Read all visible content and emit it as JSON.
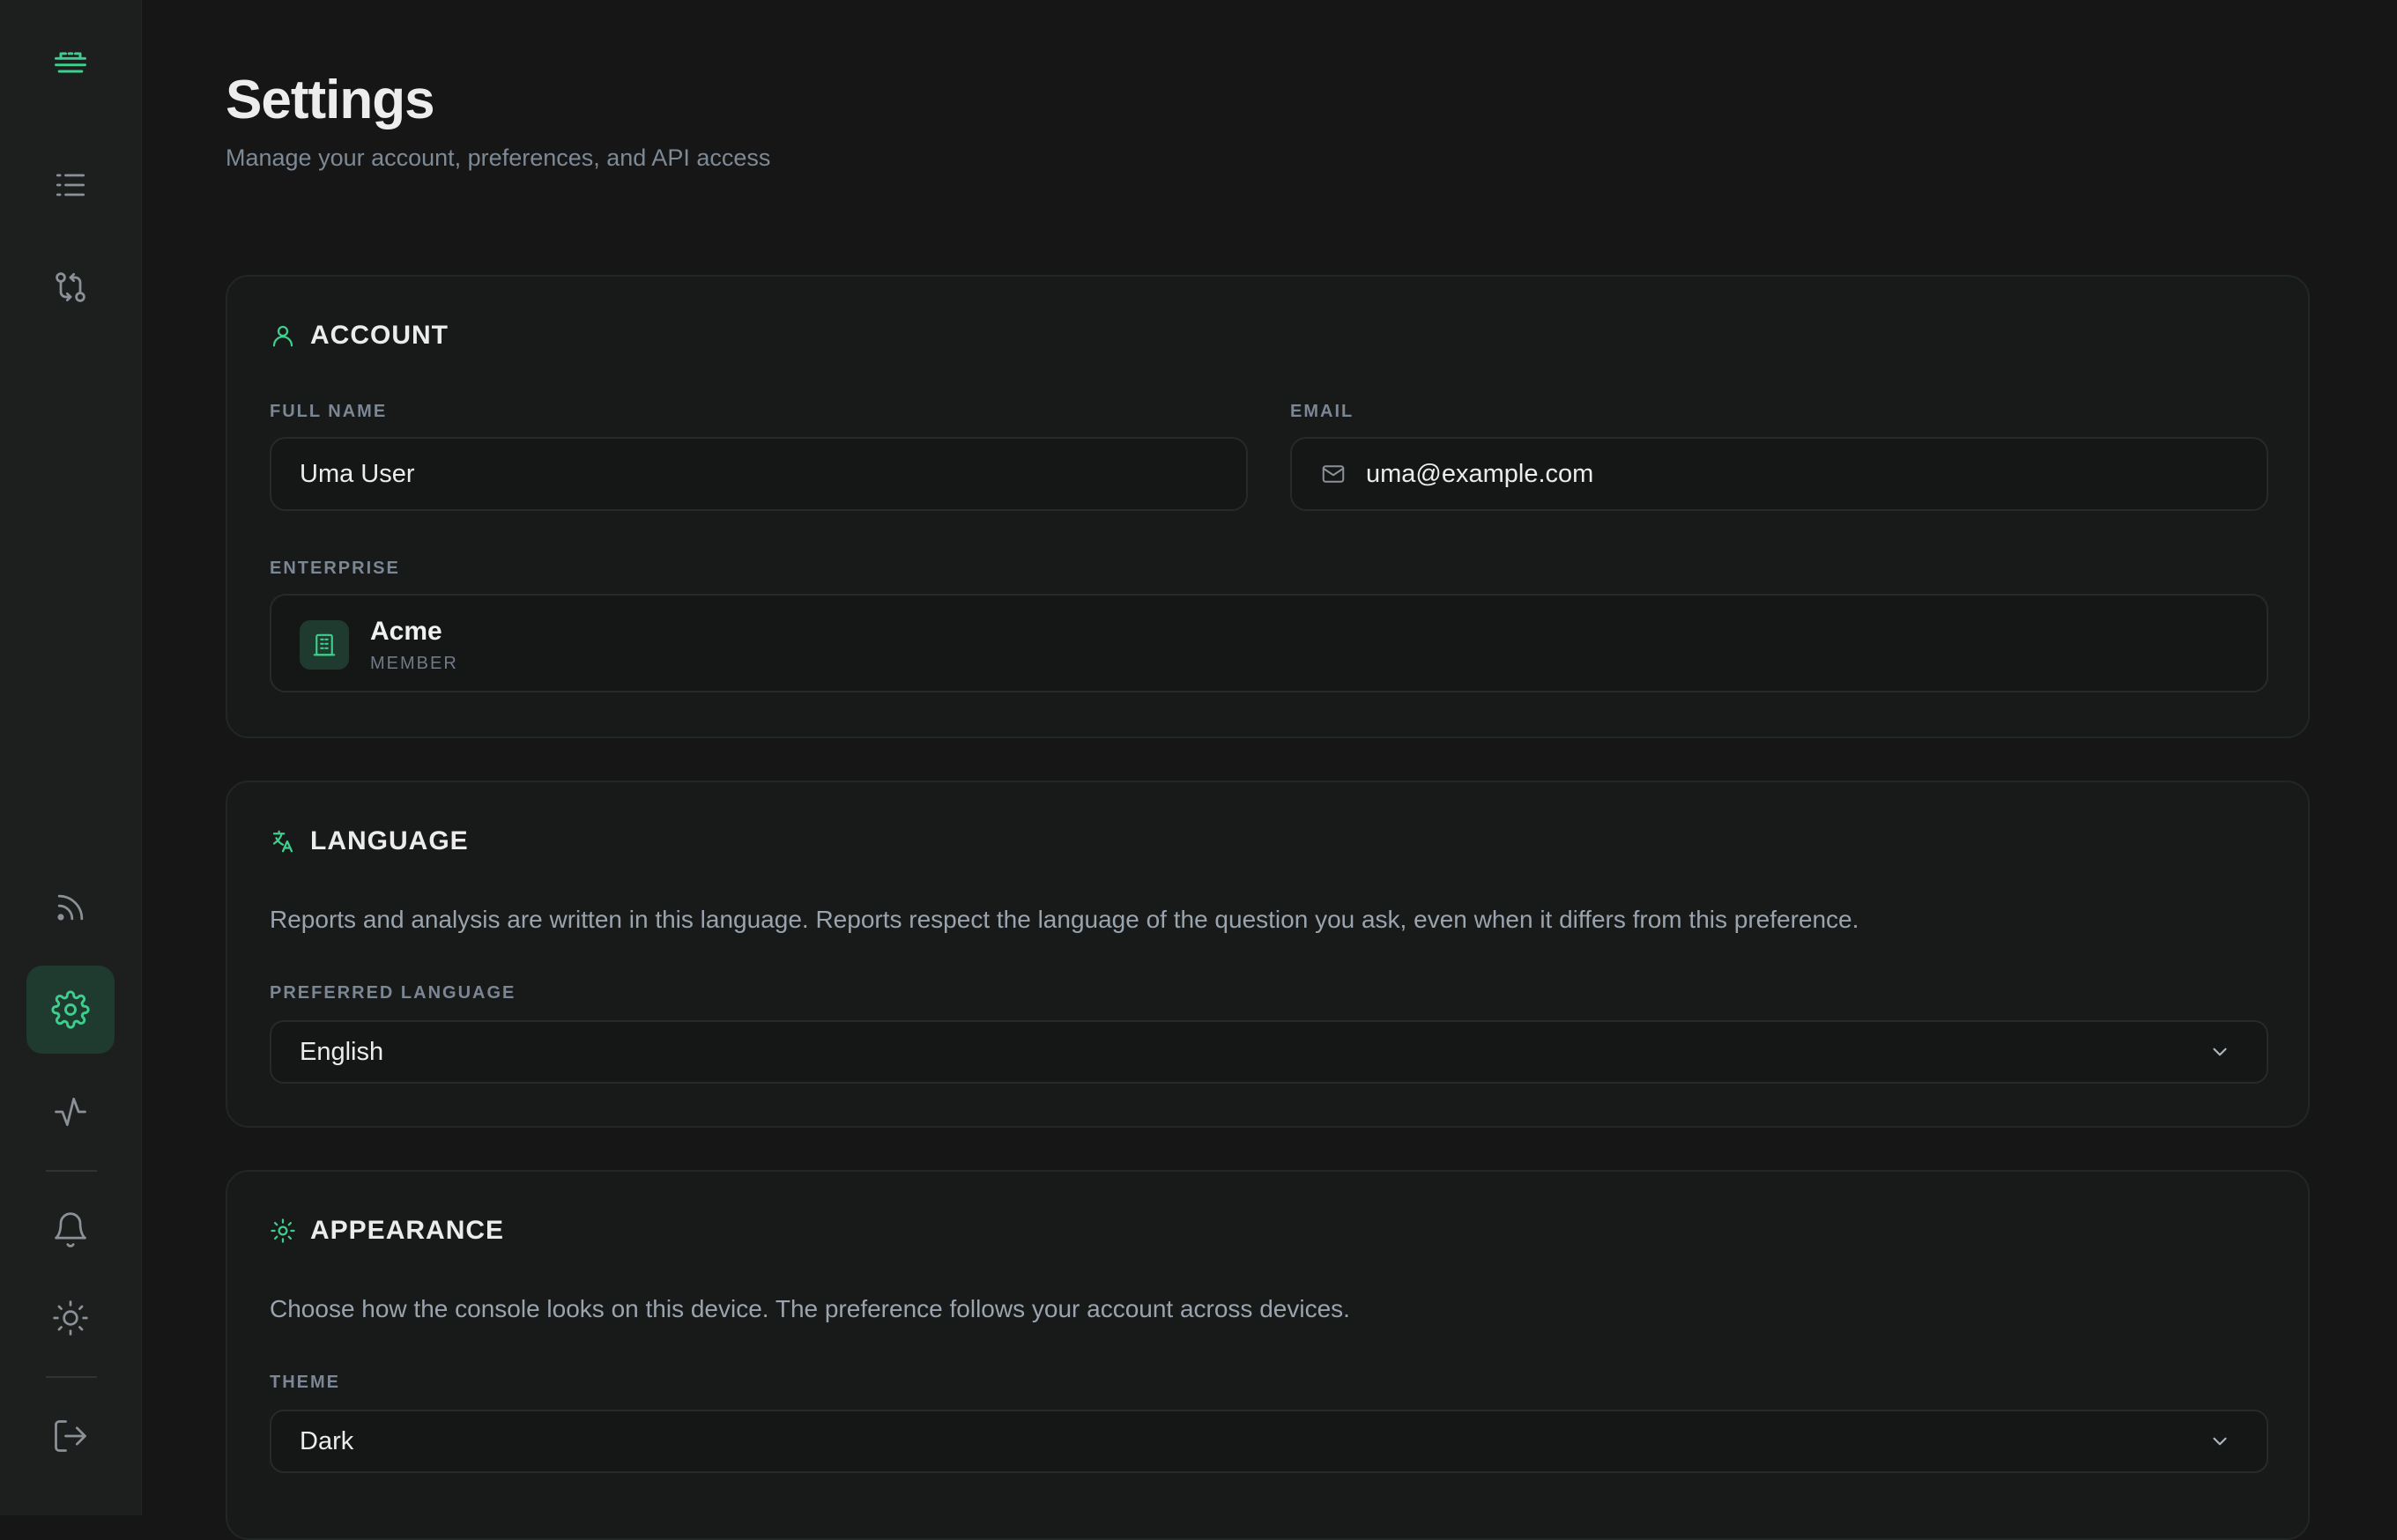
{
  "sidebar": {
    "top_items": [
      {
        "icon": "logo-icon"
      },
      {
        "icon": "list-icon"
      },
      {
        "icon": "git-compare-icon"
      }
    ],
    "bottom_items": [
      {
        "icon": "rss-feed-icon"
      },
      {
        "icon": "settings-gear-icon",
        "active": true
      },
      {
        "icon": "activity-pulse-icon"
      },
      {
        "icon": "bell-icon"
      },
      {
        "icon": "sun-icon"
      },
      {
        "icon": "logout-icon"
      }
    ],
    "accent_color": "#3ecf8e"
  },
  "header": {
    "title": "Settings",
    "subtitle": "Manage your account, preferences, and API access"
  },
  "account": {
    "title": "ACCOUNT",
    "icon": "user-icon",
    "full_name_label": "FULL NAME",
    "full_name_value": "Uma User",
    "email_label": "EMAIL",
    "email_icon": "mail-icon",
    "email_value": "uma@example.com",
    "enterprise_label": "ENTERPRISE",
    "enterprise_icon": "building-icon",
    "enterprise_name": "Acme",
    "enterprise_role": "MEMBER"
  },
  "language": {
    "title": "LANGUAGE",
    "icon": "translate-icon",
    "description": "Reports and analysis are written in this language. Reports respect the language of the question you ask, even when it differs from this preference.",
    "preferred_label": "PREFERRED LANGUAGE",
    "selected": "English"
  },
  "appearance": {
    "title": "APPEARANCE",
    "icon": "sun-icon",
    "description": "Choose how the console looks on this device. The preference follows your account across devices.",
    "theme_label": "THEME",
    "selected": "Dark"
  }
}
